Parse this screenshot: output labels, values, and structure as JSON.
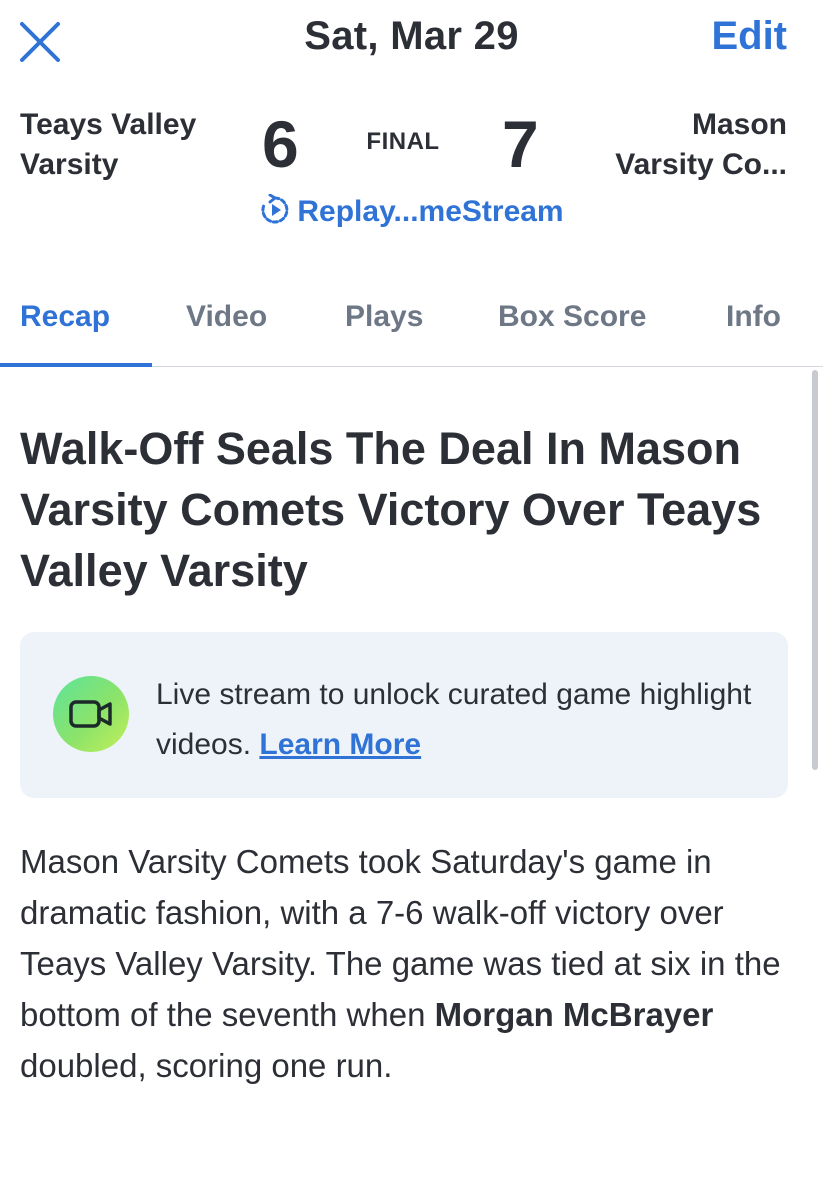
{
  "header": {
    "date": "Sat, Mar 29",
    "edit_label": "Edit",
    "close_icon": "close-icon"
  },
  "scoreboard": {
    "home_team": {
      "line1": "Teays Valley",
      "line2": "Varsity",
      "score": "6"
    },
    "away_team": {
      "line1": "Mason",
      "line2": "Varsity Co...",
      "score": "7"
    },
    "status": "FINAL",
    "replay_label": "Replay...meStream",
    "replay_icon": "replay-icon"
  },
  "tabs": [
    {
      "label": "Recap",
      "active": true
    },
    {
      "label": "Video",
      "active": false
    },
    {
      "label": "Plays",
      "active": false
    },
    {
      "label": "Box Score",
      "active": false
    },
    {
      "label": "Info",
      "active": false
    }
  ],
  "article": {
    "headline": "Walk-Off Seals The Deal In Mason Varsity Comets Victory Over Teays Valley Varsity",
    "promo": {
      "icon": "video-camera-icon",
      "text": "Live stream to unlock curated game highlight videos.",
      "link_label": "Learn More"
    },
    "body": {
      "part1": "Mason Varsity Comets took Saturday's game in dramatic fashion, with a 7-6 walk-off victory over Teays Valley Varsity. The game was tied at six in the bottom of the seventh when ",
      "player": "Morgan McBrayer",
      "part2": " doubled, scoring one run."
    }
  },
  "colors": {
    "accent": "#2f73d6",
    "text": "#2c2f36",
    "tab_inactive": "#6e7786",
    "promo_bg": "#eef3f9"
  }
}
